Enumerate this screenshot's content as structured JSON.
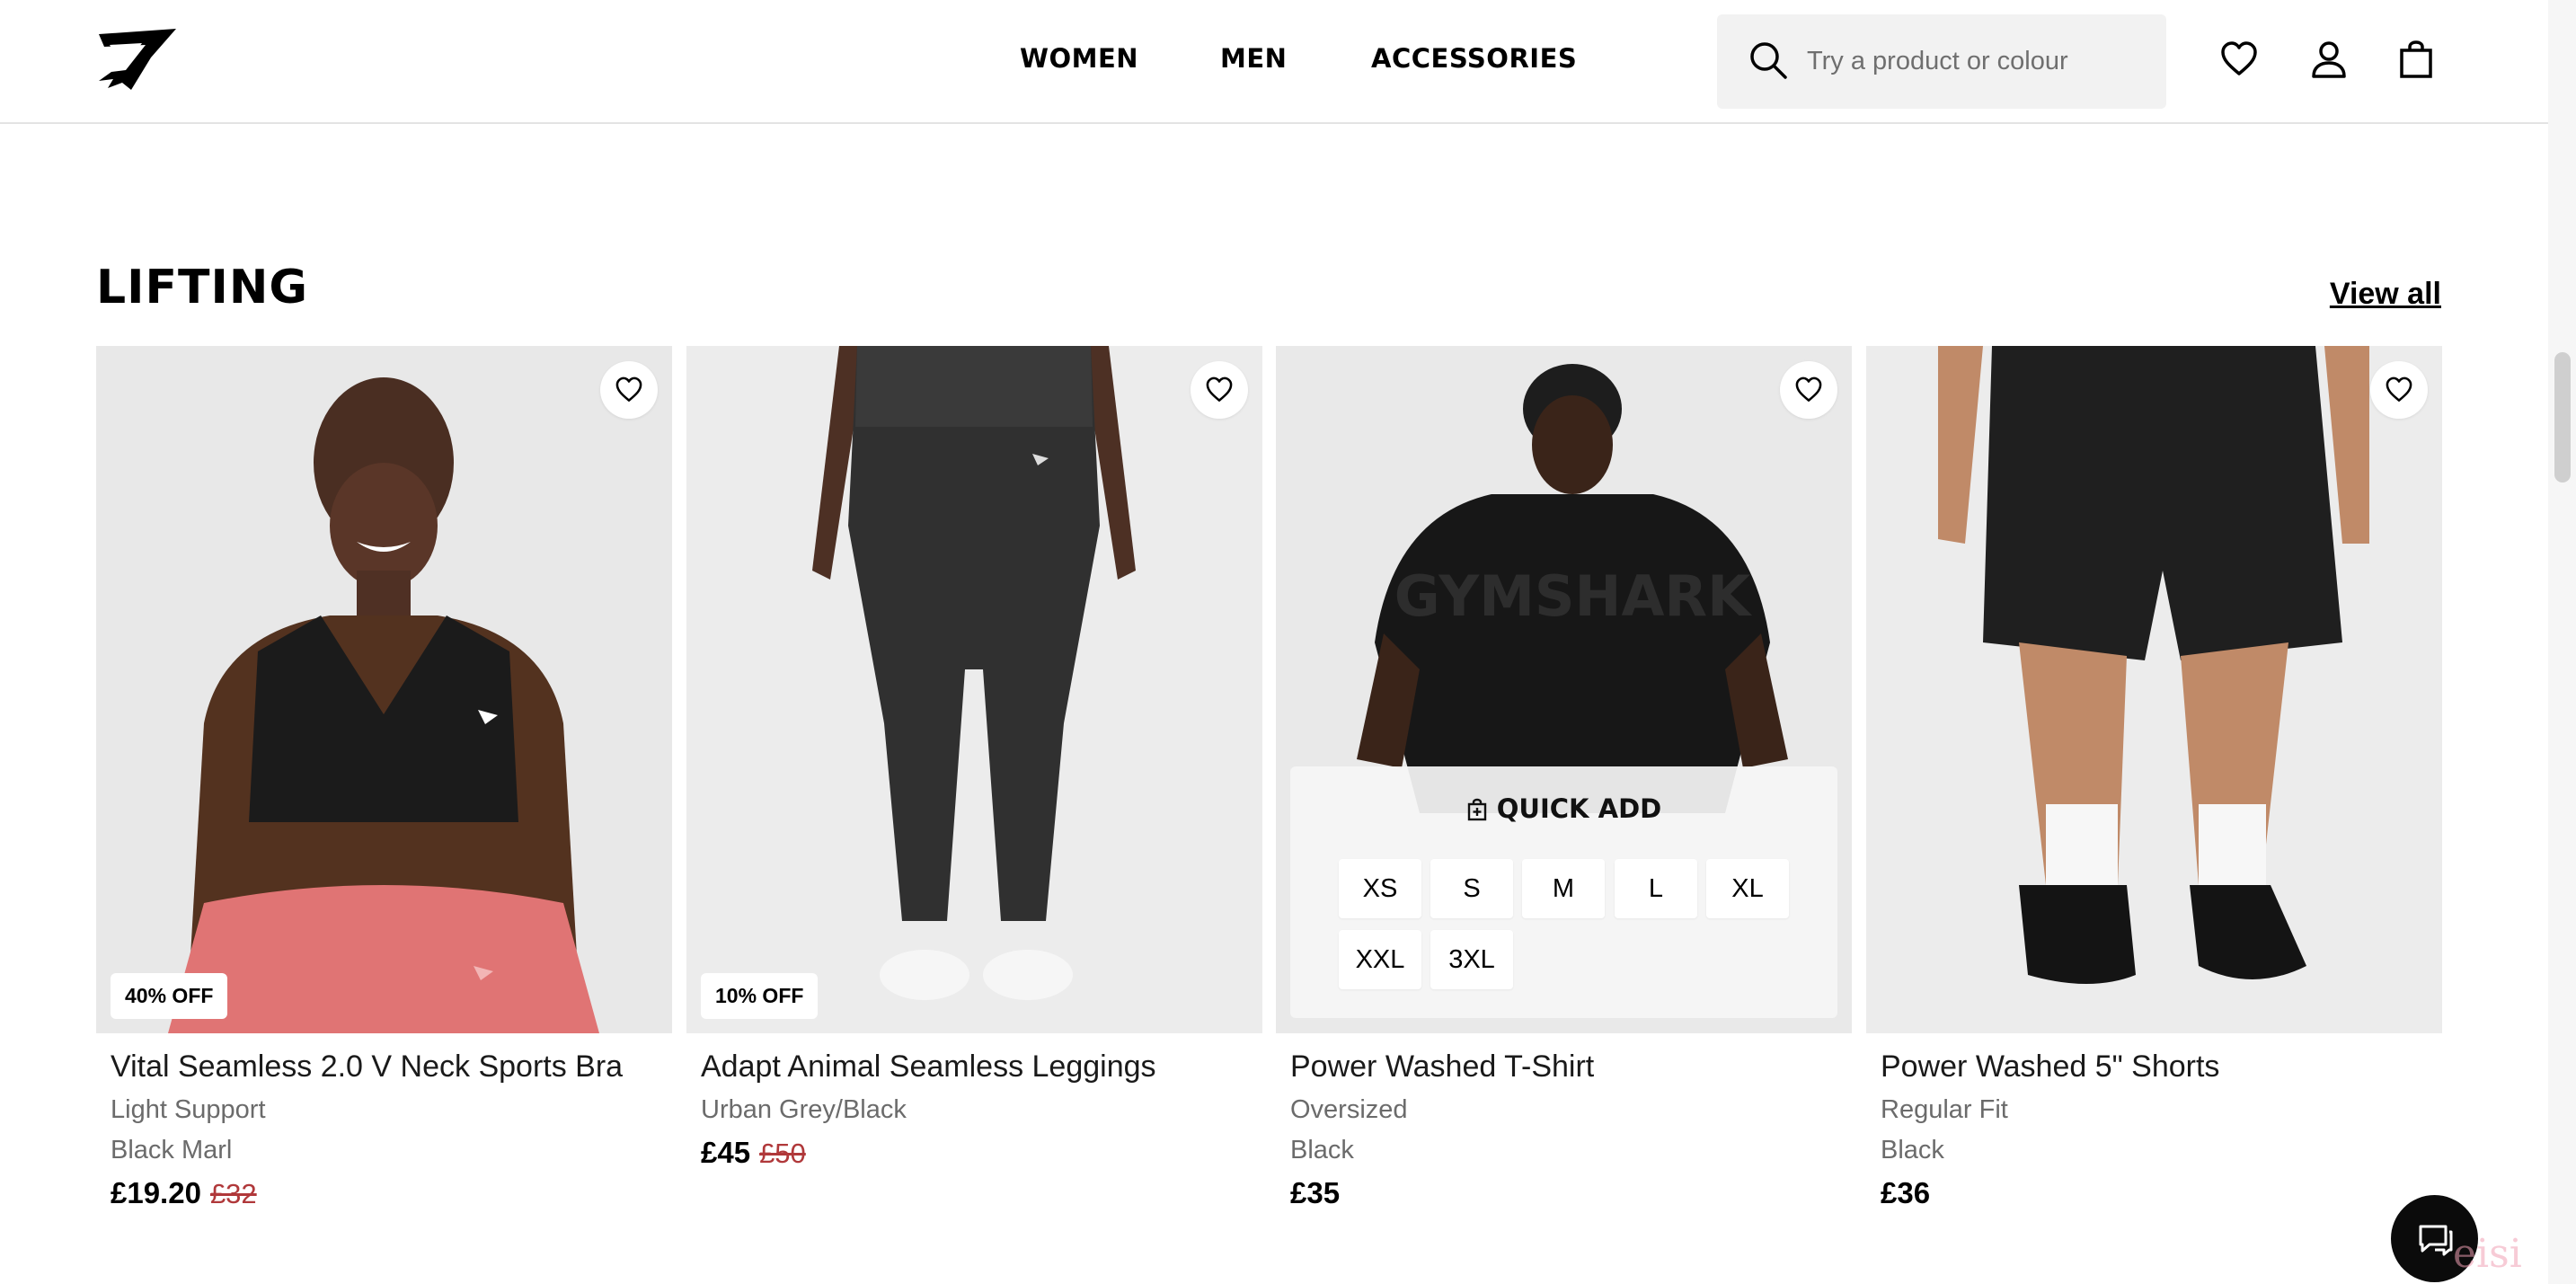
{
  "nav": {
    "women": "WOMEN",
    "men": "MEN",
    "accessories": "ACCESSORIES"
  },
  "search": {
    "placeholder": "Try a product or colour"
  },
  "section": {
    "title": "LIFTING",
    "view_all": "View all"
  },
  "products": [
    {
      "name": "Vital Seamless 2.0 V Neck Sports Bra",
      "line1": "Light Support",
      "line2": "Black Marl",
      "price": "£19.20",
      "old_price": "£32",
      "badge": "40% OFF"
    },
    {
      "name": "Adapt Animal Seamless Leggings",
      "line1": "Urban Grey/Black",
      "price": "£45",
      "old_price": "£50",
      "badge": "10% OFF"
    },
    {
      "name": "Power Washed T-Shirt",
      "line1": "Oversized",
      "line2": "Black",
      "price": "£35"
    },
    {
      "name": "Power Washed 5\" Shorts",
      "line1": "Regular Fit",
      "line2": "Black",
      "price": "£36"
    }
  ],
  "quick_add": {
    "label": "QUICK ADD",
    "sizes": [
      "XS",
      "S",
      "M",
      "L",
      "XL",
      "XXL",
      "3XL"
    ]
  },
  "tshirt_print": "GYMSHARK",
  "watermark": "eisi",
  "colors": {
    "sale": "#b0383a",
    "search_bg": "#f2f2f2",
    "image_bg": "#e9e9e9"
  }
}
